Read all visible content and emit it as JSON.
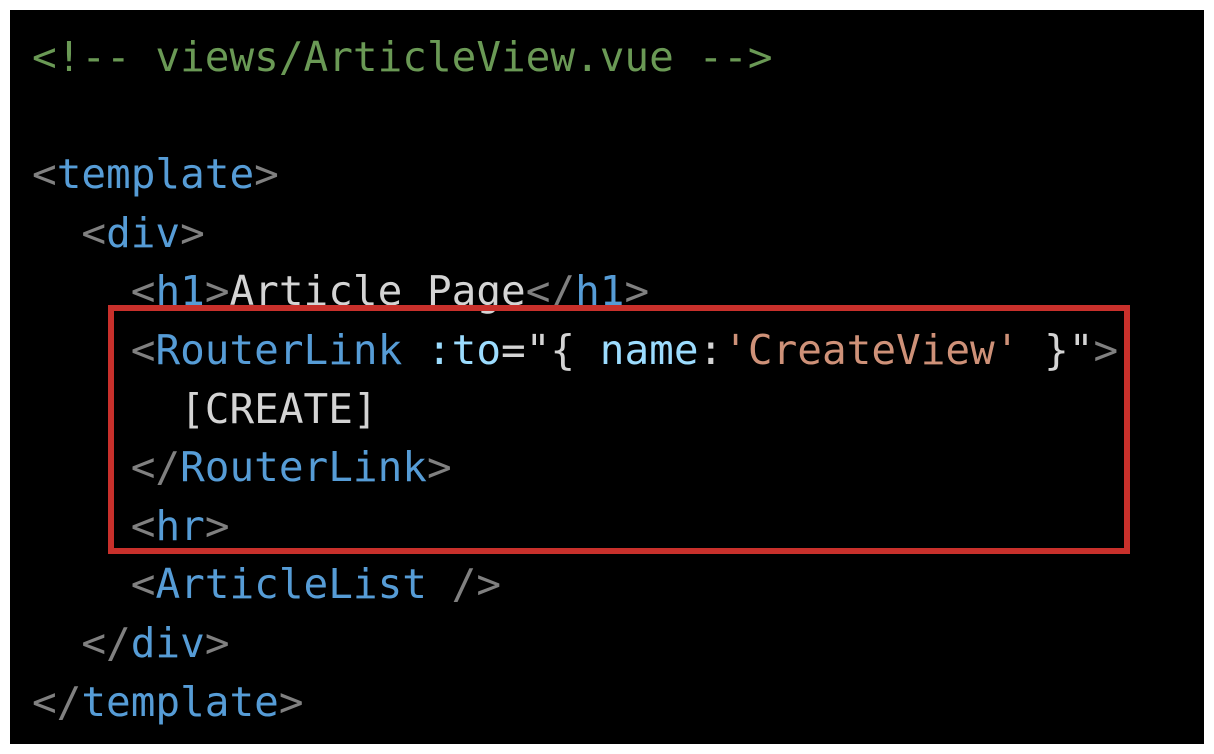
{
  "code": {
    "lines": [
      [
        {
          "t": "<!-- views/ArticleView.vue -->",
          "k": "comment"
        }
      ],
      [],
      [
        {
          "t": "<",
          "k": "bracket"
        },
        {
          "t": "template",
          "k": "tag"
        },
        {
          "t": ">",
          "k": "bracket"
        }
      ],
      [
        {
          "t": "  ",
          "k": "plain"
        },
        {
          "t": "<",
          "k": "bracket"
        },
        {
          "t": "div",
          "k": "tag"
        },
        {
          "t": ">",
          "k": "bracket"
        }
      ],
      [
        {
          "t": "    ",
          "k": "plain"
        },
        {
          "t": "<",
          "k": "bracket"
        },
        {
          "t": "h1",
          "k": "tag"
        },
        {
          "t": ">",
          "k": "bracket"
        },
        {
          "t": "Article Page",
          "k": "plain"
        },
        {
          "t": "</",
          "k": "bracket"
        },
        {
          "t": "h1",
          "k": "tag"
        },
        {
          "t": ">",
          "k": "bracket"
        }
      ],
      [
        {
          "t": "    ",
          "k": "plain"
        },
        {
          "t": "<",
          "k": "bracket"
        },
        {
          "t": "RouterLink",
          "k": "tag"
        },
        {
          "t": " ",
          "k": "plain"
        },
        {
          "t": ":to",
          "k": "attr"
        },
        {
          "t": "=\"{ ",
          "k": "plain"
        },
        {
          "t": "name",
          "k": "attr"
        },
        {
          "t": ":",
          "k": "plain"
        },
        {
          "t": "'CreateView'",
          "k": "string"
        },
        {
          "t": " }\"",
          "k": "plain"
        },
        {
          "t": ">",
          "k": "bracket"
        }
      ],
      [
        {
          "t": "      [CREATE]",
          "k": "plain"
        }
      ],
      [
        {
          "t": "    ",
          "k": "plain"
        },
        {
          "t": "</",
          "k": "bracket"
        },
        {
          "t": "RouterLink",
          "k": "tag"
        },
        {
          "t": ">",
          "k": "bracket"
        }
      ],
      [
        {
          "t": "    ",
          "k": "plain"
        },
        {
          "t": "<",
          "k": "bracket"
        },
        {
          "t": "hr",
          "k": "tag"
        },
        {
          "t": ">",
          "k": "bracket"
        }
      ],
      [
        {
          "t": "    ",
          "k": "plain"
        },
        {
          "t": "<",
          "k": "bracket"
        },
        {
          "t": "ArticleList",
          "k": "tag"
        },
        {
          "t": " />",
          "k": "bracket"
        }
      ],
      [
        {
          "t": "  ",
          "k": "plain"
        },
        {
          "t": "</",
          "k": "bracket"
        },
        {
          "t": "div",
          "k": "tag"
        },
        {
          "t": ">",
          "k": "bracket"
        }
      ],
      [
        {
          "t": "</",
          "k": "bracket"
        },
        {
          "t": "template",
          "k": "tag"
        },
        {
          "t": ">",
          "k": "bracket"
        }
      ]
    ]
  },
  "colors": {
    "background": "#000000",
    "comment": "#6a9955",
    "bracket": "#808080",
    "tag": "#569cd6",
    "attr": "#9cdcfe",
    "string": "#ce9178",
    "plain": "#d4d4d4",
    "highlight_border": "#c8302b"
  }
}
